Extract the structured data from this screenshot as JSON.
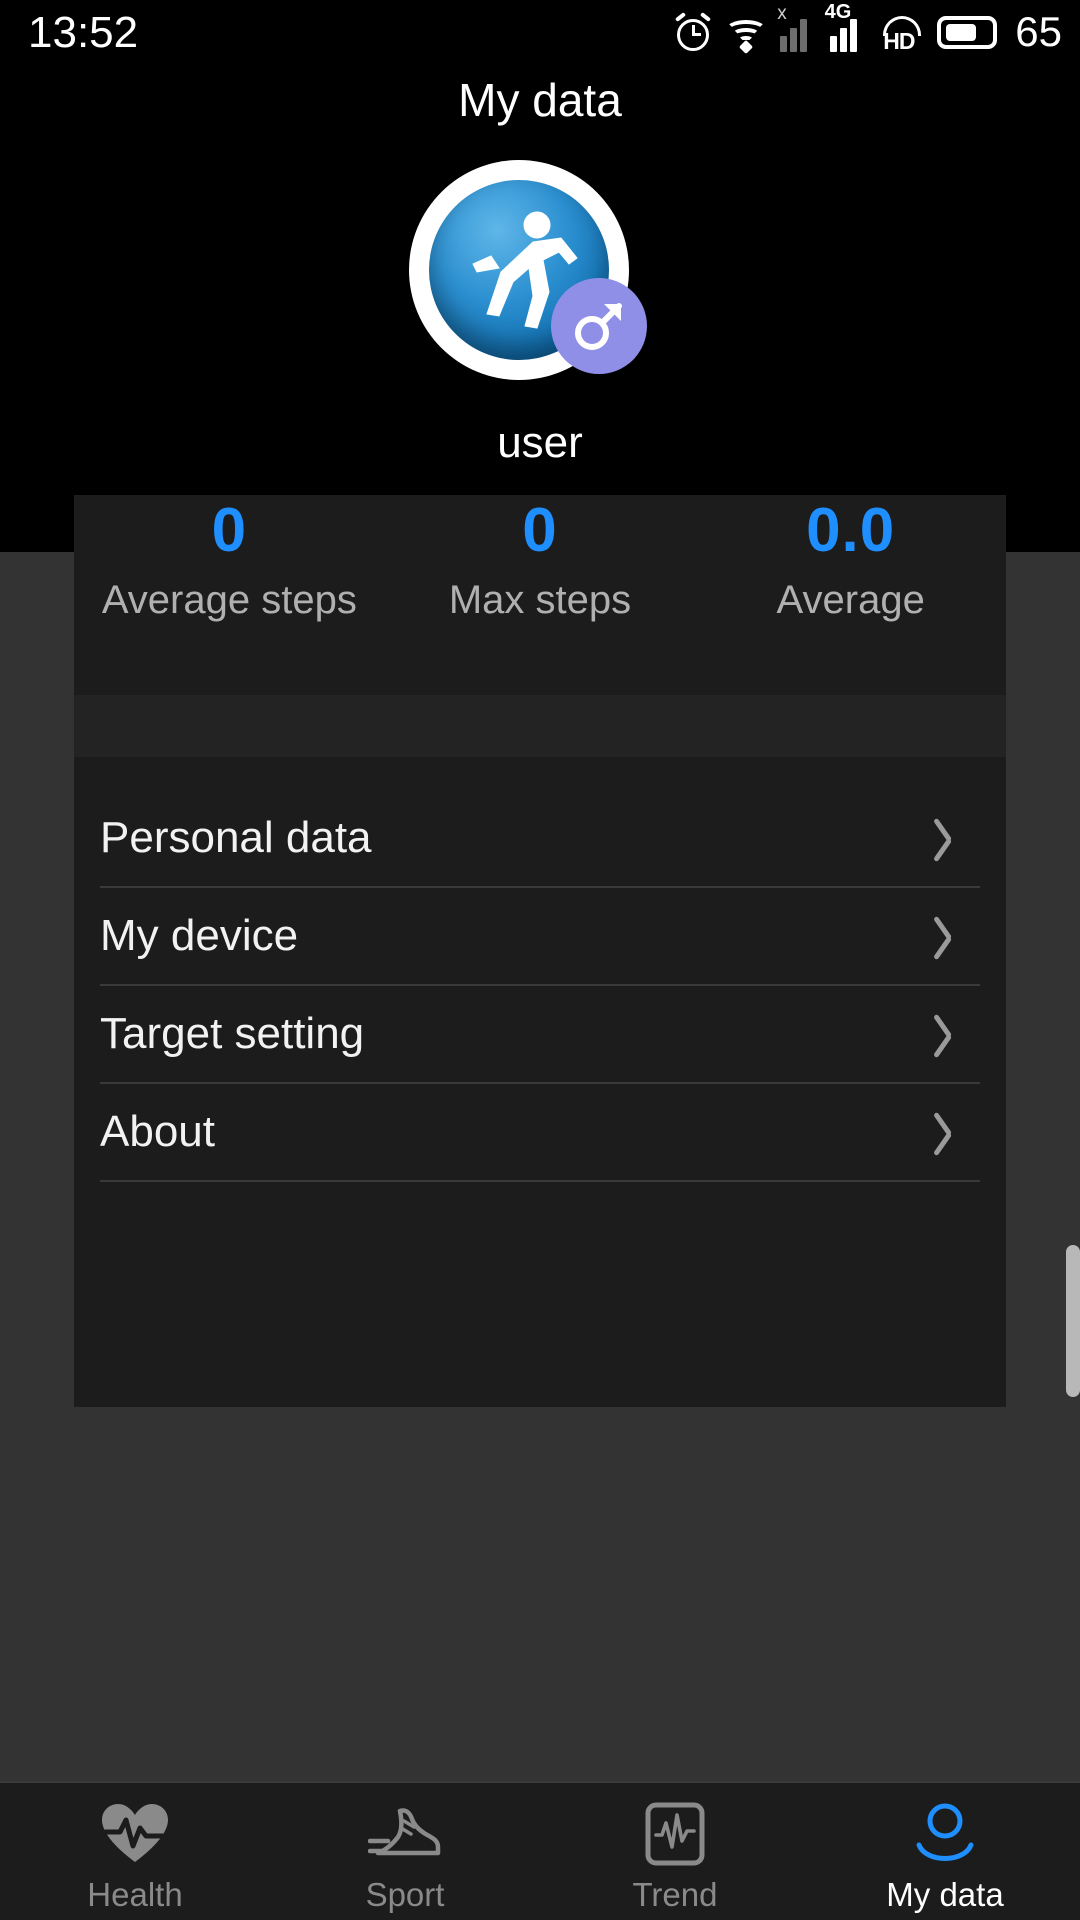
{
  "status_bar": {
    "time": "13:52",
    "battery_level": "65",
    "network_label": "4G",
    "no_service_mark": "x",
    "hd_label": "HD",
    "icons": [
      "alarm-icon",
      "wifi-icon",
      "signal-sim1-icon",
      "signal-sim2-icon",
      "hd-call-icon",
      "battery-icon"
    ]
  },
  "header": {
    "title": "My data"
  },
  "profile": {
    "name": "user",
    "avatar_icon": "running-man-avatar",
    "gender_badge_icon": "male-gender-icon",
    "gender_badge_color": "#8f8fe8"
  },
  "stats": {
    "accent_color": "#1f8fff",
    "items": [
      {
        "value": "0",
        "label": "Average steps"
      },
      {
        "value": "0",
        "label": "Max steps"
      },
      {
        "value": "0.0",
        "label": "Average"
      }
    ]
  },
  "menu": {
    "items": [
      {
        "label": "Personal data",
        "chevron": "chevron-right-icon"
      },
      {
        "label": "My device",
        "chevron": "chevron-right-icon"
      },
      {
        "label": "Target setting",
        "chevron": "chevron-right-icon"
      },
      {
        "label": "About",
        "chevron": "chevron-right-icon"
      }
    ]
  },
  "tabbar": {
    "active_color": "#1f8fff",
    "inactive_color": "#8a8a8a",
    "tabs": [
      {
        "label": "Health",
        "icon": "heart-pulse-icon",
        "active": false
      },
      {
        "label": "Sport",
        "icon": "sneaker-icon",
        "active": false
      },
      {
        "label": "Trend",
        "icon": "trend-chart-icon",
        "active": false
      },
      {
        "label": "My data",
        "icon": "person-icon",
        "active": true
      }
    ]
  }
}
